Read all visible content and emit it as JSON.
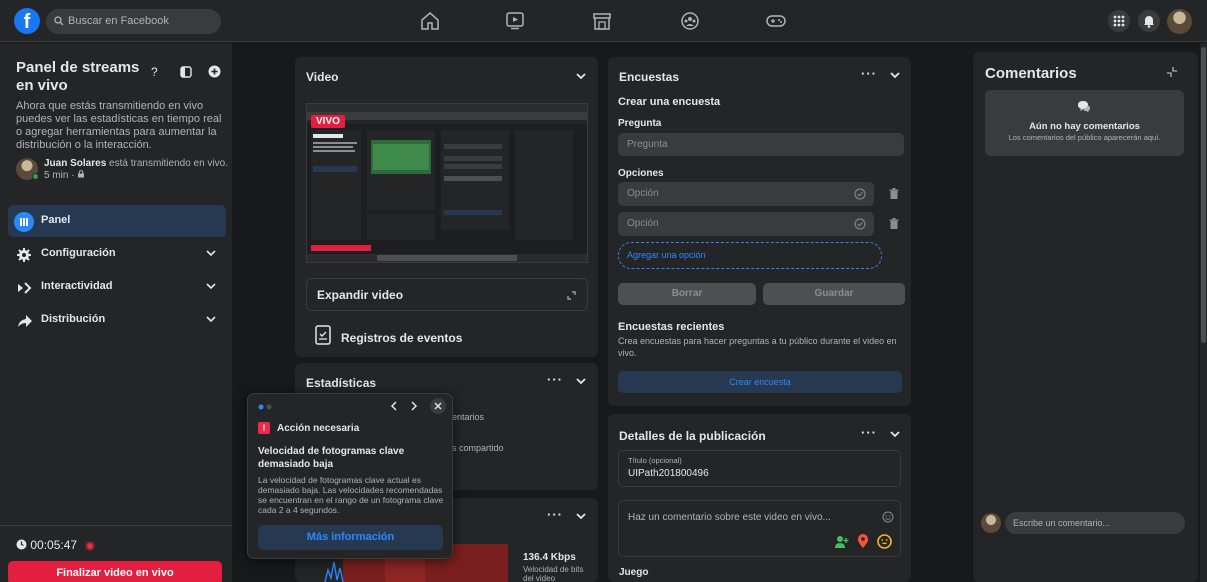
{
  "topbar": {
    "search_placeholder": "Buscar en Facebook"
  },
  "left_panel": {
    "title": "Panel de streams en vivo",
    "description": "Ahora que estás transmitiendo en vivo puedes ver las estadísticas en tiempo real o agregar herramientas para aumentar la distribución o la interacción.",
    "user_name": "Juan Solares",
    "user_status": " está transmitiendo en vivo.",
    "user_time": "5 min ·",
    "menu": [
      {
        "label": "Panel",
        "active": true
      },
      {
        "label": "Configuración",
        "active": false
      },
      {
        "label": "Interactividad",
        "active": false
      },
      {
        "label": "Distribución",
        "active": false
      }
    ],
    "timer": "00:05:47",
    "end_button": "Finalizar video en vivo"
  },
  "video_card": {
    "title": "Video",
    "live_badge": "VIVO",
    "expand_label": "Expandir video",
    "events_label": "Registros de eventos"
  },
  "stats_card": {
    "title": "Estadísticas",
    "partial_1": "entarios",
    "partial_2": "s compartido",
    "bitrate_value": "136.4 Kbps",
    "bitrate_label": "Velocidad de bits del video"
  },
  "popup": {
    "header": "Acción necesaria",
    "title": "Velocidad de fotogramas clave demasiado baja",
    "body": "La velocidad de fotogramas clave actual es demasiado baja. Las velocidades recomendadas se encuentran en el rango de un fotograma clave cada 2 a 4 segundos.",
    "button": "Más información"
  },
  "polls_card": {
    "title": "Encuestas",
    "create_heading": "Crear una encuesta",
    "question_label": "Pregunta",
    "question_placeholder": "Pregunta",
    "options_label": "Opciones",
    "option_placeholder_1": "Opción",
    "option_placeholder_2": "Opción",
    "add_option": "Agregar una opción",
    "clear_button": "Borrar",
    "save_button": "Guardar",
    "recent_heading": "Encuestas recientes",
    "recent_desc": "Crea encuestas para hacer preguntas a tu público durante el video en vivo.",
    "create_button": "Crear encuesta"
  },
  "details_card": {
    "title": "Detalles de la publicación",
    "title_field_label": "Título (opcional)",
    "title_field_value": "UIPath201800496",
    "comment_placeholder": "Haz un comentario sobre este video en vivo...",
    "game_label": "Juego"
  },
  "comments_panel": {
    "title": "Comentarios",
    "empty_title": "Aún no hay comentarios",
    "empty_desc": "Los comentarios del público aparecerán aquí.",
    "input_placeholder": "Escribe un comentario..."
  },
  "colors": {
    "accent": "#2d88ff",
    "live_red": "#e41e3f",
    "card_bg": "#242526",
    "page_bg": "#18191a"
  }
}
